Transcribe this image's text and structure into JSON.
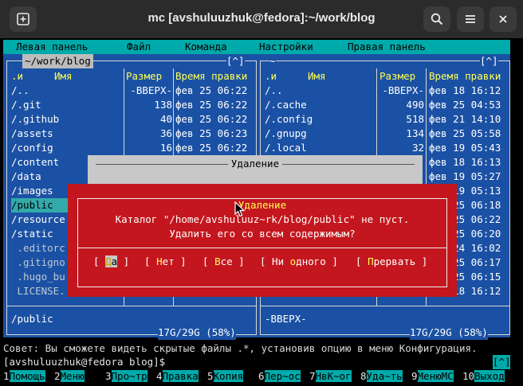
{
  "window": {
    "title": "mc [avshuluuzhuk@fedora]:~/work/blog"
  },
  "menubar": [
    "Левая панель",
    "Файл",
    "Команда",
    "Настройки",
    "Правая панель"
  ],
  "left_panel": {
    "path": "~/work/blog",
    "corner": "[^]",
    "col_n": ".и",
    "col_name": "Имя",
    "col_size": "Размер",
    "col_time": "Время правки",
    "rows": [
      {
        "name": "/..",
        "size": "-ВВЕРХ-",
        "time": "фев 25 06:22"
      },
      {
        "name": "/.git",
        "size": "138",
        "time": "фев 25 06:22"
      },
      {
        "name": "/.github",
        "size": "40",
        "time": "фев 25 06:22"
      },
      {
        "name": "/assets",
        "size": "36",
        "time": "фев 25 06:23"
      },
      {
        "name": "/config",
        "size": "16",
        "time": "фев 25 06:22"
      },
      {
        "name": "/content",
        "size": "",
        "time": ""
      },
      {
        "name": "/data",
        "size": "",
        "time": ""
      },
      {
        "name": "/images",
        "size": "",
        "time": ""
      },
      {
        "name": "/public",
        "size": "",
        "time": ""
      },
      {
        "name": "/resource",
        "size": "",
        "time": ""
      },
      {
        "name": "/static",
        "size": "",
        "time": ""
      },
      {
        "name": " .editorc",
        "size": "",
        "time": ""
      },
      {
        "name": " .gitigno",
        "size": "",
        "time": ""
      },
      {
        "name": " .hugo_bu",
        "size": "",
        "time": ""
      },
      {
        "name": " LICENSE.",
        "size": "",
        "time": ""
      }
    ],
    "status": "/public",
    "disk": "17G/29G (58%)"
  },
  "right_panel": {
    "path": "~",
    "corner": "[^]",
    "col_n": ".и",
    "col_name": "Имя",
    "col_size": "Размер",
    "col_time": "Время правки",
    "rows": [
      {
        "name": "/..",
        "size": "-ВВЕРХ-",
        "time": "фев 18 16:12"
      },
      {
        "name": "/.cache",
        "size": "490",
        "time": "фев 25 04:53"
      },
      {
        "name": "/.config",
        "size": "518",
        "time": "фев 21 14:10"
      },
      {
        "name": "/.gnupg",
        "size": "134",
        "time": "фев 25 05:58"
      },
      {
        "name": "/.local",
        "size": "32",
        "time": "фев 19 05:43"
      },
      {
        "name": "",
        "size": "",
        "time": "фев 18 16:13"
      },
      {
        "name": "",
        "size": "",
        "time": "фев 19 05:27"
      },
      {
        "name": "",
        "size": "",
        "time": "фев 19 05:13"
      },
      {
        "name": "",
        "size": "",
        "time": "фев 25 06:18"
      },
      {
        "name": "",
        "size": "",
        "time": "фев 25 06:22"
      },
      {
        "name": "",
        "size": "",
        "time": "фев 25 06:20"
      },
      {
        "name": "",
        "size": "",
        "time": "фев 24 16:02"
      },
      {
        "name": "",
        "size": "",
        "time": "фев 25 06:17"
      },
      {
        "name": "",
        "size": "",
        "time": "фев 25 06:15"
      },
      {
        "name": "",
        "size": "",
        "time": "фев 18 16:12"
      }
    ],
    "status": "-ВВЕРХ-",
    "disk": "17G/29G (58%)"
  },
  "bg_dialog": {
    "title": "Удаление"
  },
  "confirm": {
    "title": "Удаление",
    "line1": "Каталог \"/home/avshuluuz~rk/blog/public\" не пуст.",
    "line2": "Удалить его со всем содержимым?",
    "buttons": [
      {
        "pre": "[ ",
        "hot": "Д",
        "rest": "а",
        "post": " ]"
      },
      {
        "pre": "[ ",
        "hot": "Н",
        "rest": "ет",
        "post": " ]"
      },
      {
        "pre": "[ ",
        "hot": "В",
        "rest": "се",
        "post": " ]"
      },
      {
        "pre": "[ Ни ",
        "hot": "о",
        "rest": "дного",
        "post": " ]"
      },
      {
        "pre": "[ ",
        "hot": "П",
        "rest": "рервать",
        "post": " ]"
      }
    ]
  },
  "hint": "Совет: Вы сможете видеть скрытые файлы .*, установив опцию в меню Конфигурация.",
  "prompt": "[avshuluuzhuk@fedora blog]$",
  "prompt_mark": "[^]",
  "fkeys": [
    {
      "n": "1",
      "label": "Помощь"
    },
    {
      "n": "2",
      "label": "Меню"
    },
    {
      "n": "3",
      "label": "Про~тр"
    },
    {
      "n": "4",
      "label": "Правка"
    },
    {
      "n": "5",
      "label": "Копия"
    },
    {
      "n": "6",
      "label": "Пер~ос"
    },
    {
      "n": "7",
      "label": "НвК~ог"
    },
    {
      "n": "8",
      "label": "Уда~ть"
    },
    {
      "n": "9",
      "label": "МенюMC"
    },
    {
      "n": "10",
      "label": "Выход"
    }
  ],
  "colors": {
    "panel": "#1b51a4",
    "menubar": "#00aaaa",
    "dialog": "#c4161e",
    "highlight": "#ffff55"
  }
}
